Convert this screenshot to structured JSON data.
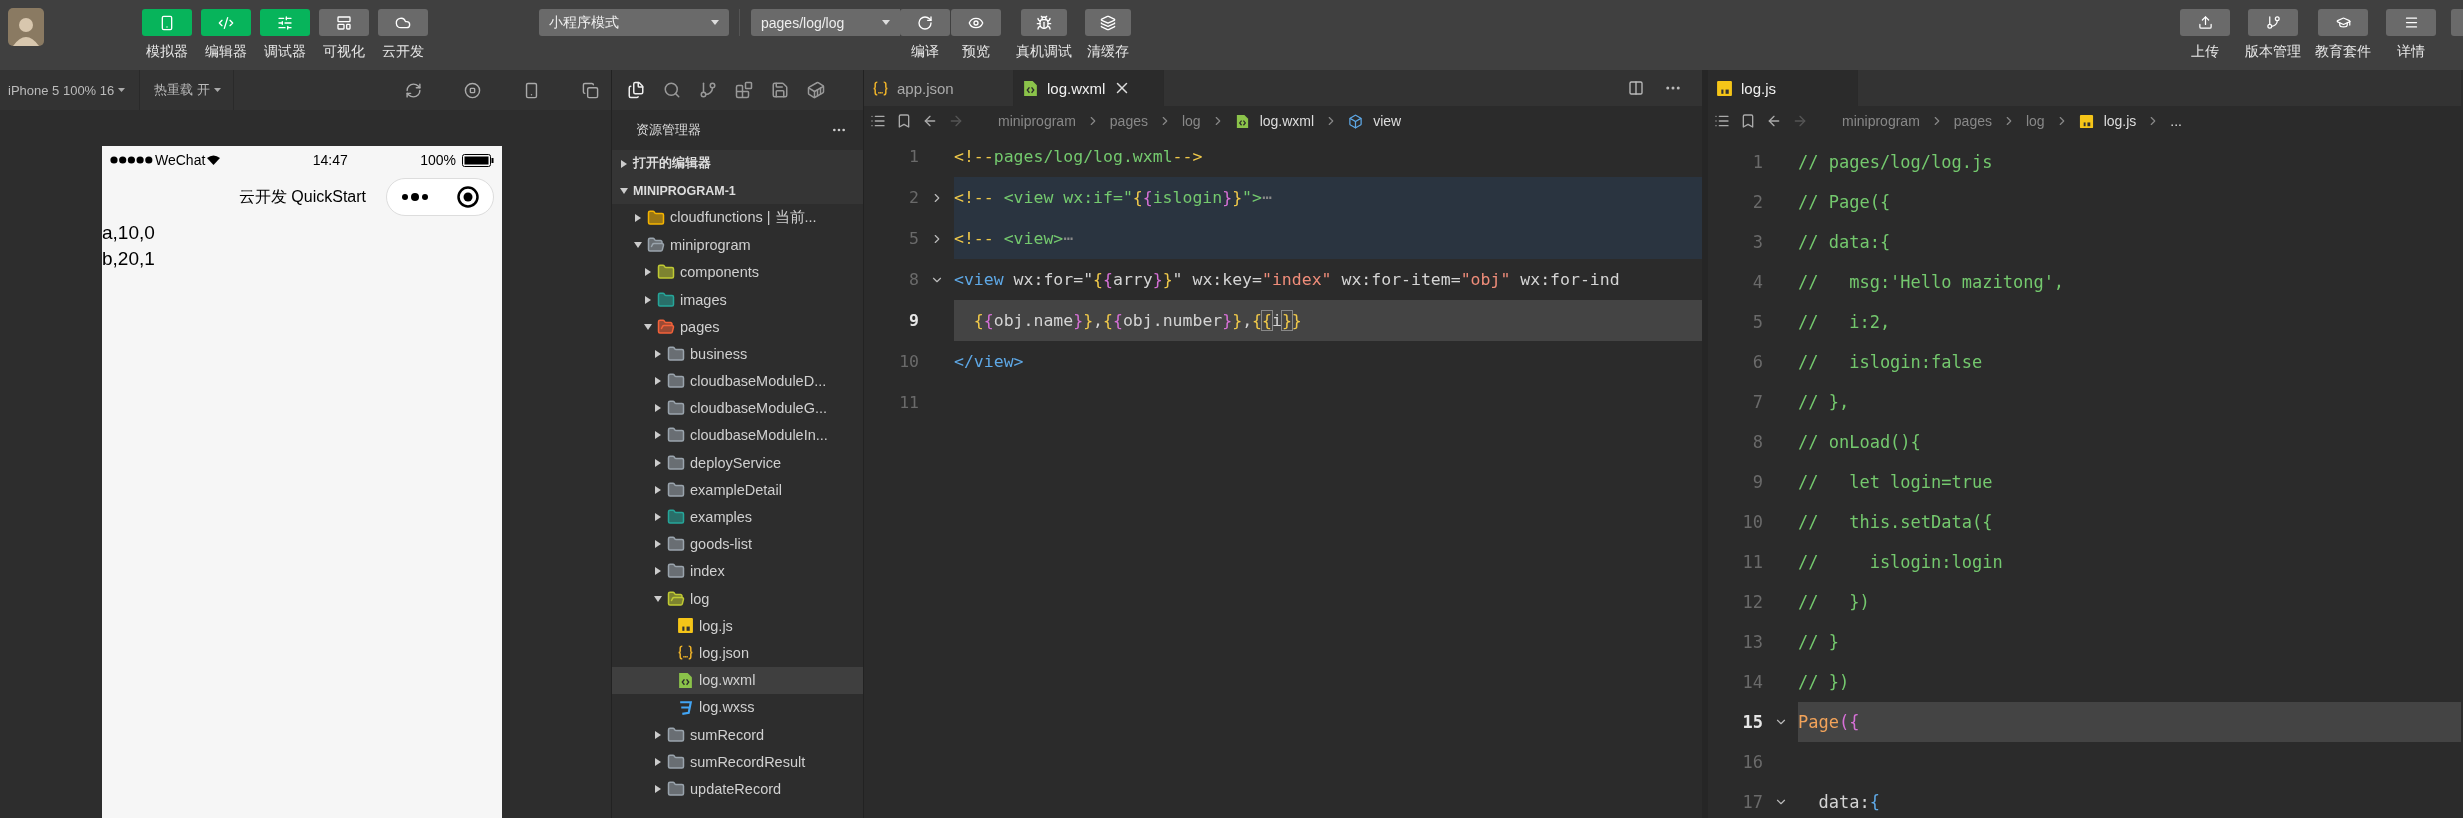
{
  "toolbar": {
    "view_buttons": [
      {
        "label": "模拟器",
        "selected": true
      },
      {
        "label": "编辑器",
        "selected": true
      },
      {
        "label": "调试器",
        "selected": true
      },
      {
        "label": "可视化",
        "selected": false
      },
      {
        "label": "云开发",
        "selected": false
      }
    ],
    "mode_select": {
      "value": "小程序模式"
    },
    "page_select": {
      "value": "pages/log/log"
    },
    "page_actions": [
      {
        "label": "编译"
      },
      {
        "label": "预览"
      },
      {
        "label": "真机调试"
      },
      {
        "label": "清缓存"
      }
    ],
    "right_buttons": [
      {
        "kind": "button",
        "label": "上传"
      },
      {
        "kind": "button",
        "label": "版本管理"
      },
      {
        "kind": "button",
        "label": "教育套件"
      },
      {
        "kind": "button",
        "label": "详情"
      },
      {
        "kind": "cut"
      }
    ]
  },
  "simulator": {
    "device": "iPhone 5 100% 16",
    "hot_reload": "热重载 开",
    "phone": {
      "carrier": "WeChat",
      "time": "14:47",
      "battery": "100%",
      "title": "云开发 QuickStart",
      "lines": [
        "a,10,0",
        "b,20,1"
      ]
    }
  },
  "explorer": {
    "title": "资源管理器",
    "sections": [
      {
        "label": "打开的编辑器",
        "expanded": false
      },
      {
        "label": "MINIPROGRAM-1",
        "expanded": true,
        "children": [
          {
            "label": "cloudfunctions | 当前...",
            "kind": "cloud",
            "expanded": false,
            "selected": false
          },
          {
            "label": "miniprogram",
            "kind": "folder-plain",
            "expanded": true,
            "selected": false,
            "children": [
              {
                "label": "components",
                "kind": "components",
                "expanded": false,
                "selected": false
              },
              {
                "label": "images",
                "kind": "images",
                "expanded": false,
                "selected": false
              },
              {
                "label": "pages",
                "kind": "pages",
                "expanded": true,
                "selected": false,
                "children": [
                  {
                    "label": "business",
                    "kind": "folder",
                    "expanded": false,
                    "selected": false
                  },
                  {
                    "label": "cloudbaseModuleD...",
                    "kind": "folder",
                    "expanded": false,
                    "selected": false
                  },
                  {
                    "label": "cloudbaseModuleG...",
                    "kind": "folder",
                    "expanded": false,
                    "selected": false
                  },
                  {
                    "label": "cloudbaseModuleIn...",
                    "kind": "folder",
                    "expanded": false,
                    "selected": false
                  },
                  {
                    "label": "deployService",
                    "kind": "folder",
                    "expanded": false,
                    "selected": false
                  },
                  {
                    "label": "exampleDetail",
                    "kind": "folder",
                    "expanded": false,
                    "selected": false
                  },
                  {
                    "label": "examples",
                    "kind": "images",
                    "expanded": false,
                    "selected": false
                  },
                  {
                    "label": "goods-list",
                    "kind": "folder",
                    "expanded": false,
                    "selected": false
                  },
                  {
                    "label": "index",
                    "kind": "folder",
                    "expanded": false,
                    "selected": false
                  },
                  {
                    "label": "log",
                    "kind": "log",
                    "expanded": true,
                    "selected": false,
                    "children": [
                      {
                        "label": "log.js",
                        "kind": "js",
                        "selected": false
                      },
                      {
                        "label": "log.json",
                        "kind": "json",
                        "selected": false
                      },
                      {
                        "label": "log.wxml",
                        "kind": "wxml",
                        "selected": true
                      },
                      {
                        "label": "log.wxss",
                        "kind": "wxss",
                        "selected": false
                      }
                    ]
                  },
                  {
                    "label": "sumRecord",
                    "kind": "folder",
                    "expanded": false,
                    "selected": false
                  },
                  {
                    "label": "sumRecordResult",
                    "kind": "folder",
                    "expanded": false,
                    "selected": false
                  },
                  {
                    "label": "updateRecord",
                    "kind": "folder",
                    "expanded": false,
                    "selected": false
                  }
                ]
              }
            ]
          }
        ]
      }
    ]
  },
  "editors": [
    {
      "tabs": [
        {
          "label": "app.json",
          "kind": "json",
          "selected": false
        },
        {
          "label": "log.wxml",
          "kind": "wxml",
          "selected": true
        }
      ],
      "breadcrumb": [
        {
          "label": "miniprogram",
          "kind": "text"
        },
        {
          "label": "pages",
          "kind": "text"
        },
        {
          "label": "log",
          "kind": "text"
        },
        {
          "label": "log.wxml",
          "kind": "wxml"
        },
        {
          "label": "view",
          "kind": "element"
        }
      ],
      "lines": [
        {
          "n": "1",
          "current": false,
          "selected": false,
          "tokens": [
            {
              "kind": "p",
              "text": "<!--"
            },
            {
              "kind": "c",
              "text": "pages/log/log.wxml"
            },
            {
              "kind": "p",
              "text": "-->"
            }
          ]
        },
        {
          "n": "2",
          "collapsed": true,
          "current": false,
          "selected": true,
          "tokens": [
            {
              "kind": "p",
              "text": "<!-- "
            },
            {
              "kind": "c",
              "text": "<view wx:if=\""
            },
            {
              "kind": "b",
              "text": "{"
            },
            {
              "kind": "b2",
              "text": "{"
            },
            {
              "kind": "c",
              "text": "islogin"
            },
            {
              "kind": "b2",
              "text": "}"
            },
            {
              "kind": "b",
              "text": "}"
            },
            {
              "kind": "c",
              "text": "\">"
            },
            {
              "kind": "f",
              "text": "⋯"
            }
          ]
        },
        {
          "n": "5",
          "collapsed": true,
          "current": false,
          "selected": true,
          "tokens": [
            {
              "kind": "p",
              "text": "<!-- "
            },
            {
              "kind": "c",
              "text": "<view>"
            },
            {
              "kind": "f",
              "text": "⋯"
            }
          ]
        },
        {
          "n": "8",
          "collapsed": false,
          "current": false,
          "selected": false,
          "tokens": [
            {
              "kind": "t",
              "text": "<view"
            },
            {
              "kind": "a",
              "text": " wx:for=\""
            },
            {
              "kind": "b",
              "text": "{"
            },
            {
              "kind": "b2",
              "text": "{"
            },
            {
              "kind": "a",
              "text": "arry"
            },
            {
              "kind": "b2",
              "text": "}"
            },
            {
              "kind": "b",
              "text": "}"
            },
            {
              "kind": "a",
              "text": "\" wx:key="
            },
            {
              "kind": "s",
              "text": "\"index\""
            },
            {
              "kind": "a",
              "text": " wx:for-item="
            },
            {
              "kind": "s",
              "text": "\"obj\""
            },
            {
              "kind": "a",
              "text": " wx:for-ind"
            }
          ]
        },
        {
          "n": "9",
          "current": true,
          "selected": false,
          "tokens": [
            {
              "kind": "b",
              "text": "  {"
            },
            {
              "kind": "b2",
              "text": "{"
            },
            {
              "kind": "a",
              "text": "obj.name"
            },
            {
              "kind": "b2",
              "text": "}"
            },
            {
              "kind": "b",
              "text": "}"
            },
            {
              "kind": "a",
              "text": ","
            },
            {
              "kind": "b",
              "text": "{"
            },
            {
              "kind": "b2",
              "text": "{"
            },
            {
              "kind": "a",
              "text": "obj.number"
            },
            {
              "kind": "b2",
              "text": "}"
            },
            {
              "kind": "b",
              "text": "}"
            },
            {
              "kind": "a",
              "text": ","
            },
            {
              "kind": "b",
              "text": "{"
            },
            {
              "kind": "m",
              "text": "{"
            },
            {
              "kind": "a",
              "text": "i"
            },
            {
              "kind": "m",
              "text": "}"
            },
            {
              "kind": "b",
              "text": "}"
            }
          ]
        },
        {
          "n": "10",
          "current": false,
          "selected": false,
          "tokens": [
            {
              "kind": "t",
              "text": "</view>"
            }
          ]
        },
        {
          "n": "11",
          "current": false,
          "selected": false
        }
      ]
    },
    {
      "tabs": [
        {
          "label": "log.js",
          "kind": "js",
          "selected": true
        }
      ],
      "breadcrumb": [
        {
          "label": "miniprogram",
          "kind": "text"
        },
        {
          "label": "pages",
          "kind": "text"
        },
        {
          "label": "log",
          "kind": "text"
        },
        {
          "label": "log.js",
          "kind": "js"
        },
        {
          "label": "...",
          "kind": "text"
        }
      ],
      "lines": [
        {
          "n": "1",
          "current": false,
          "selected": false,
          "tokens": [
            {
              "kind": "c",
              "text": "// pages/log/log.js"
            }
          ]
        },
        {
          "n": "2",
          "current": false,
          "selected": false,
          "tokens": [
            {
              "kind": "c",
              "text": "// Page({"
            }
          ]
        },
        {
          "n": "3",
          "current": false,
          "selected": false,
          "tokens": [
            {
              "kind": "c",
              "text": "// data:{"
            }
          ]
        },
        {
          "n": "4",
          "current": false,
          "selected": false,
          "tokens": [
            {
              "kind": "c",
              "text": "//   msg:'Hello mazitong',"
            }
          ]
        },
        {
          "n": "5",
          "current": false,
          "selected": false,
          "tokens": [
            {
              "kind": "c",
              "text": "//   i:2,"
            }
          ]
        },
        {
          "n": "6",
          "current": false,
          "selected": false,
          "tokens": [
            {
              "kind": "c",
              "text": "//   islogin:false"
            }
          ]
        },
        {
          "n": "7",
          "current": false,
          "selected": false,
          "tokens": [
            {
              "kind": "c",
              "text": "// },"
            }
          ]
        },
        {
          "n": "8",
          "current": false,
          "selected": false,
          "tokens": [
            {
              "kind": "c",
              "text": "// onLoad(){"
            }
          ]
        },
        {
          "n": "9",
          "current": false,
          "selected": false,
          "tokens": [
            {
              "kind": "c",
              "text": "//   let login=true"
            }
          ]
        },
        {
          "n": "10",
          "current": false,
          "selected": false,
          "tokens": [
            {
              "kind": "c",
              "text": "//   this.setData({"
            }
          ]
        },
        {
          "n": "11",
          "current": false,
          "selected": false,
          "tokens": [
            {
              "kind": "c",
              "text": "//     islogin:login"
            }
          ]
        },
        {
          "n": "12",
          "current": false,
          "selected": false,
          "tokens": [
            {
              "kind": "c",
              "text": "//   })"
            }
          ]
        },
        {
          "n": "13",
          "current": false,
          "selected": false,
          "tokens": [
            {
              "kind": "c",
              "text": "// }"
            }
          ]
        },
        {
          "n": "14",
          "current": false,
          "selected": false,
          "tokens": [
            {
              "kind": "c",
              "text": "// })"
            }
          ]
        },
        {
          "n": "15",
          "collapsed": false,
          "current": true,
          "selected": false,
          "tokens": [
            {
              "kind": "fn",
              "text": "Page"
            },
            {
              "kind": "b2",
              "text": "({"
            }
          ]
        },
        {
          "n": "16",
          "current": false,
          "selected": false
        },
        {
          "n": "17",
          "collapsed": false,
          "current": false,
          "selected": false,
          "tokens": [
            {
              "kind": "a",
              "text": "  data:"
            },
            {
              "kind": "t",
              "text": "{"
            }
          ]
        }
      ]
    }
  ]
}
